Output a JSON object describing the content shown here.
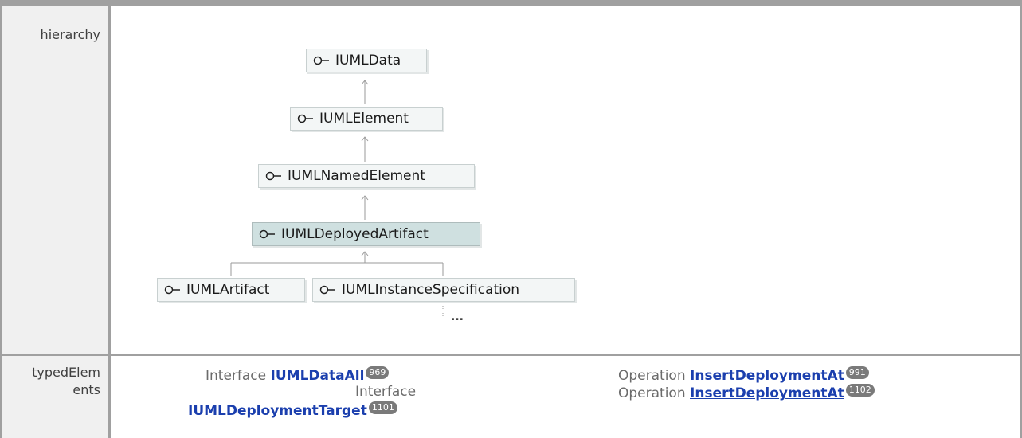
{
  "rows": {
    "hierarchy": {
      "label": "hierarchy",
      "nodes": {
        "iumldata": "IUMLData",
        "iumlelement": "IUMLElement",
        "iumlnamedelement": "IUMLNamedElement",
        "iumldeployedartifact": "IUMLDeployedArtifact",
        "iumlartifact": "IUMLArtifact",
        "iumlinstancespecification": "IUMLInstanceSpecification"
      },
      "more": "..."
    },
    "typed_elements": {
      "label_line1": "typedElem",
      "label_line2": "ents",
      "left": [
        {
          "kind": "Interface",
          "name": "IUMLDataAll",
          "badge": "969"
        },
        {
          "kind": "Interface",
          "name": "IUMLDeploymentTarget",
          "badge": "1101"
        }
      ],
      "right": [
        {
          "kind": "Operation",
          "name": "InsertDeploymentAt",
          "badge": "991"
        },
        {
          "kind": "Operation",
          "name": "InsertDeploymentAt",
          "badge": "1102"
        }
      ]
    }
  },
  "colors": {
    "link": "#1b3fae",
    "selected_node": "#cfe0e0",
    "node": "#f3f6f6",
    "badge": "#7a7a7a"
  },
  "icons": {
    "interface": "interface-lollipop-icon"
  }
}
